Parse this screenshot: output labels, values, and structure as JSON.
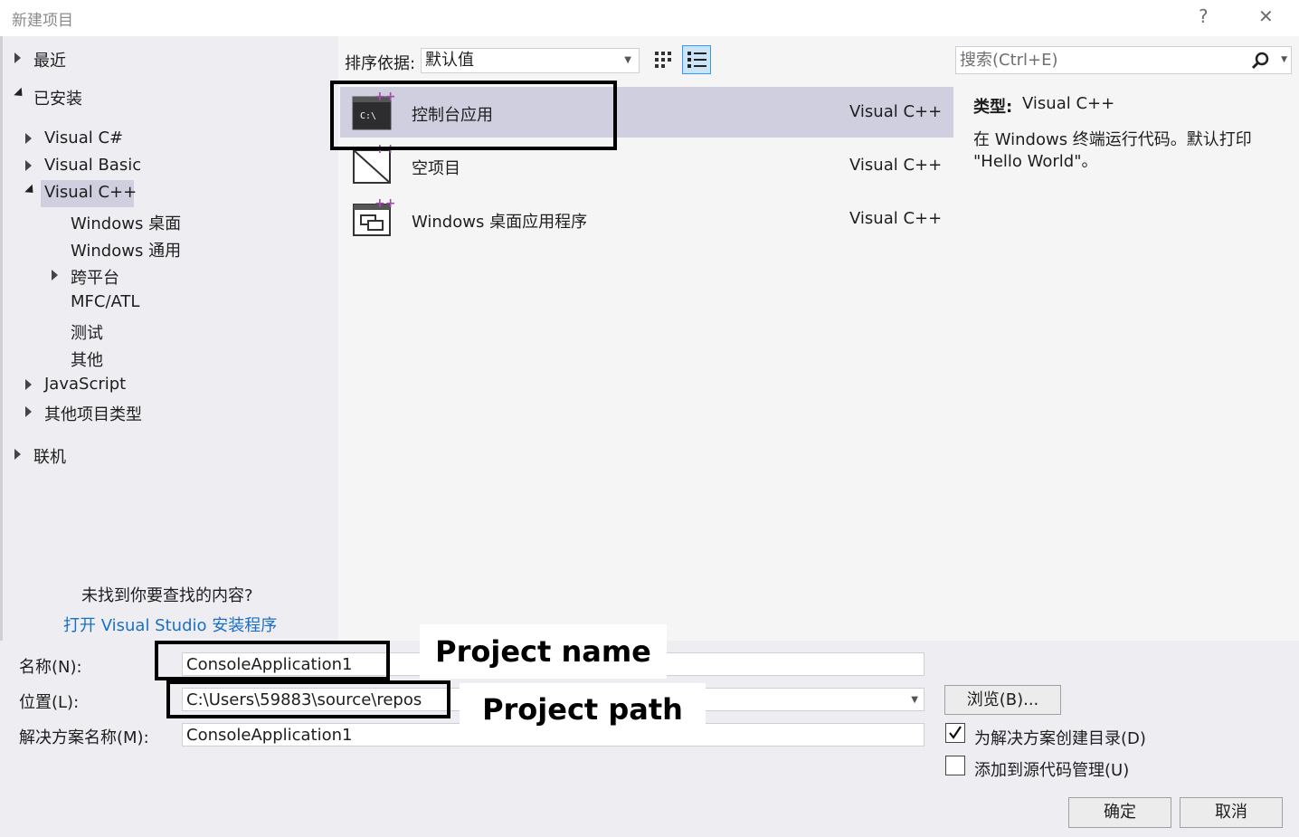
{
  "window": {
    "title": "新建项目",
    "help": "?",
    "close": "✕"
  },
  "tree": {
    "recent": "最近",
    "installed": "已安装",
    "csharp": "Visual C#",
    "vb": "Visual Basic",
    "cpp": "Visual C++",
    "win_desktop": "Windows 桌面",
    "win_universal": "Windows 通用",
    "cross_platform": "跨平台",
    "mfc": "MFC/ATL",
    "test": "测试",
    "other": "其他",
    "javascript": "JavaScript",
    "other_types": "其他项目类型",
    "online": "联机",
    "not_found": "未找到你要查找的内容?",
    "open_installer": "打开 Visual Studio 安装程序"
  },
  "toolbar": {
    "sort_label": "排序依据:",
    "sort_value": "默认值"
  },
  "search": {
    "placeholder": "搜索(Ctrl+E)"
  },
  "templates": [
    {
      "name": "控制台应用",
      "lang": "Visual C++",
      "icon": "console-app-icon"
    },
    {
      "name": "空项目",
      "lang": "Visual C++",
      "icon": "empty-project-icon"
    },
    {
      "name": "Windows 桌面应用程序",
      "lang": "Visual C++",
      "icon": "desktop-app-icon"
    }
  ],
  "details": {
    "type_label": "类型:",
    "type_value": "Visual C++",
    "desc_line1": "在 Windows 终端运行代码。默认打印",
    "desc_line2": "\"Hello World\"。"
  },
  "form": {
    "name_label": "名称(N):",
    "name_value": "ConsoleApplication1",
    "location_label": "位置(L):",
    "location_value": "C:\\Users\\59883\\source\\repos",
    "solution_label": "解决方案名称(M):",
    "solution_value": "ConsoleApplication1",
    "browse": "浏览(B)...",
    "create_dir": "为解决方案创建目录(D)",
    "create_dir_checked": true,
    "add_scm": "添加到源代码管理(U)",
    "ok": "确定",
    "cancel": "取消"
  },
  "callouts": {
    "project_name": "Project name",
    "project_path": "Project path"
  },
  "colors": {
    "link": "#1a6fc4",
    "selected": "#cfcfdf",
    "pane": "#eeeef2",
    "accent_plus": "#a04ea8"
  }
}
